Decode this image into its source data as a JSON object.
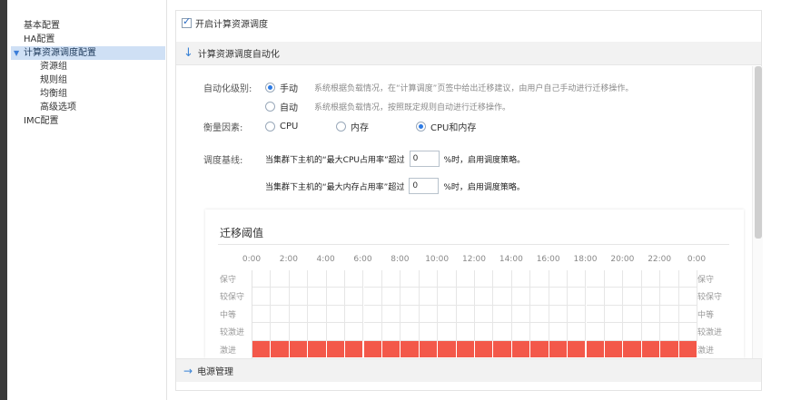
{
  "sidebar": {
    "items": [
      {
        "label": "基本配置",
        "level": 0,
        "selected": false
      },
      {
        "label": "HA配置",
        "level": 0,
        "selected": false
      },
      {
        "label": "计算资源调度配置",
        "level": 0,
        "selected": true,
        "expanded": true
      },
      {
        "label": "资源组",
        "level": 1,
        "selected": false
      },
      {
        "label": "规则组",
        "level": 1,
        "selected": false
      },
      {
        "label": "均衡组",
        "level": 1,
        "selected": false
      },
      {
        "label": "高级选项",
        "level": 1,
        "selected": false
      },
      {
        "label": "IMC配置",
        "level": 0,
        "selected": false
      }
    ]
  },
  "enable": {
    "label": "开启计算资源调度",
    "checked": true
  },
  "section": {
    "title": "计算资源调度自动化",
    "icon": "arrow-down-icon"
  },
  "automation": {
    "label": "自动化级别:",
    "options": [
      {
        "label": "手动",
        "desc": "系统根据负载情况，在“计算调度”页签中给出迁移建议，由用户自己手动进行迁移操作。",
        "selected": true
      },
      {
        "label": "自动",
        "desc": "系统根据负载情况，按照既定规则自动进行迁移操作。",
        "selected": false
      }
    ]
  },
  "metric": {
    "label": "衡量因素:",
    "options": [
      {
        "label": "CPU",
        "selected": false
      },
      {
        "label": "内存",
        "selected": false
      },
      {
        "label": "CPU和内存",
        "selected": true
      }
    ]
  },
  "threshold": {
    "label": "调度基线:",
    "cpu": {
      "prefix": "当集群下主机的“最大CPU占用率”超过",
      "value": "0",
      "suffix": "%时，启用调度策略。"
    },
    "mem": {
      "prefix": "当集群下主机的“最大内存占用率”超过",
      "value": "0",
      "suffix": "%时，启用调度策略。"
    }
  },
  "migration": {
    "title": "迁移阈值",
    "hours": [
      "0:00",
      "2:00",
      "4:00",
      "6:00",
      "8:00",
      "10:00",
      "12:00",
      "14:00",
      "16:00",
      "18:00",
      "20:00",
      "22:00",
      "0:00"
    ],
    "levels": [
      "保守",
      "较保守",
      "中等",
      "较激进",
      "激进"
    ],
    "selected_level": "激进",
    "fill_color": "#f3584a"
  },
  "power": {
    "title": "电源管理",
    "icon": "arrow-right-icon"
  }
}
